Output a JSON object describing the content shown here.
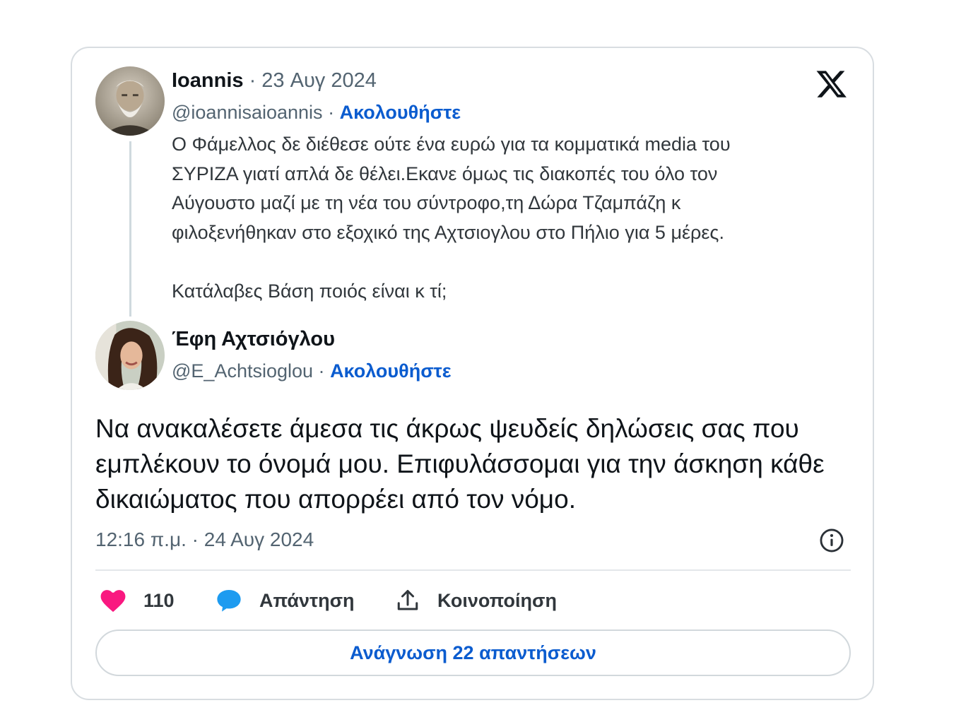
{
  "quoted": {
    "name": "Ioannis",
    "date": "· 23 Αυγ 2024",
    "handle": "@ioannisaioannis",
    "separator": "·",
    "follow_label": "Ακολουθήστε",
    "text": "Ο Φάμελλος δε διέθεσε ούτε ένα ευρώ για τα κομματικά media του\nΣΥΡΙΖΑ γιατί απλά δε θέλει.Εκανε όμως τις διακοπές του όλο τον\nΑύγουστο μαζί με τη νέα του σύντροφο,τη Δώρα Τζαμπάζη κ\nφιλοξενήθηκαν στο εξοχικό της Αχτσιογλου στο Πήλιο για 5 μέρες.\n\nΚατάλαβες Βάση ποιός είναι κ τί;"
  },
  "tweet": {
    "name": "Έφη Αχτσιόγλου",
    "handle": "@E_Achtsioglou",
    "separator": "·",
    "follow_label": "Ακολουθήστε",
    "text": "Να ανακαλέσετε άμεσα τις άκρως ψευδείς δηλώσεις σας που εμπλέκουν το όνομά μου. Επιφυλάσσομαι για την άσκηση κάθε δικαιώματος που απορρέει από τον νόμο.",
    "timestamp": "12:16 π.μ. · 24 Αυγ 2024"
  },
  "actions": {
    "likes_count": "110",
    "reply_label": "Απάντηση",
    "share_label": "Κοινοποίηση"
  },
  "read_replies_label": "Ανάγνωση 22 απαντήσεων",
  "icons": [
    "x-logo-icon",
    "info-icon",
    "heart-icon",
    "reply-bubble-icon",
    "share-icon"
  ],
  "colors": {
    "link_blue": "#0b5ccf",
    "heart_pink": "#f91880",
    "reply_blue": "#1d9bf0",
    "muted_text": "#536471",
    "border": "#d8dde1"
  }
}
